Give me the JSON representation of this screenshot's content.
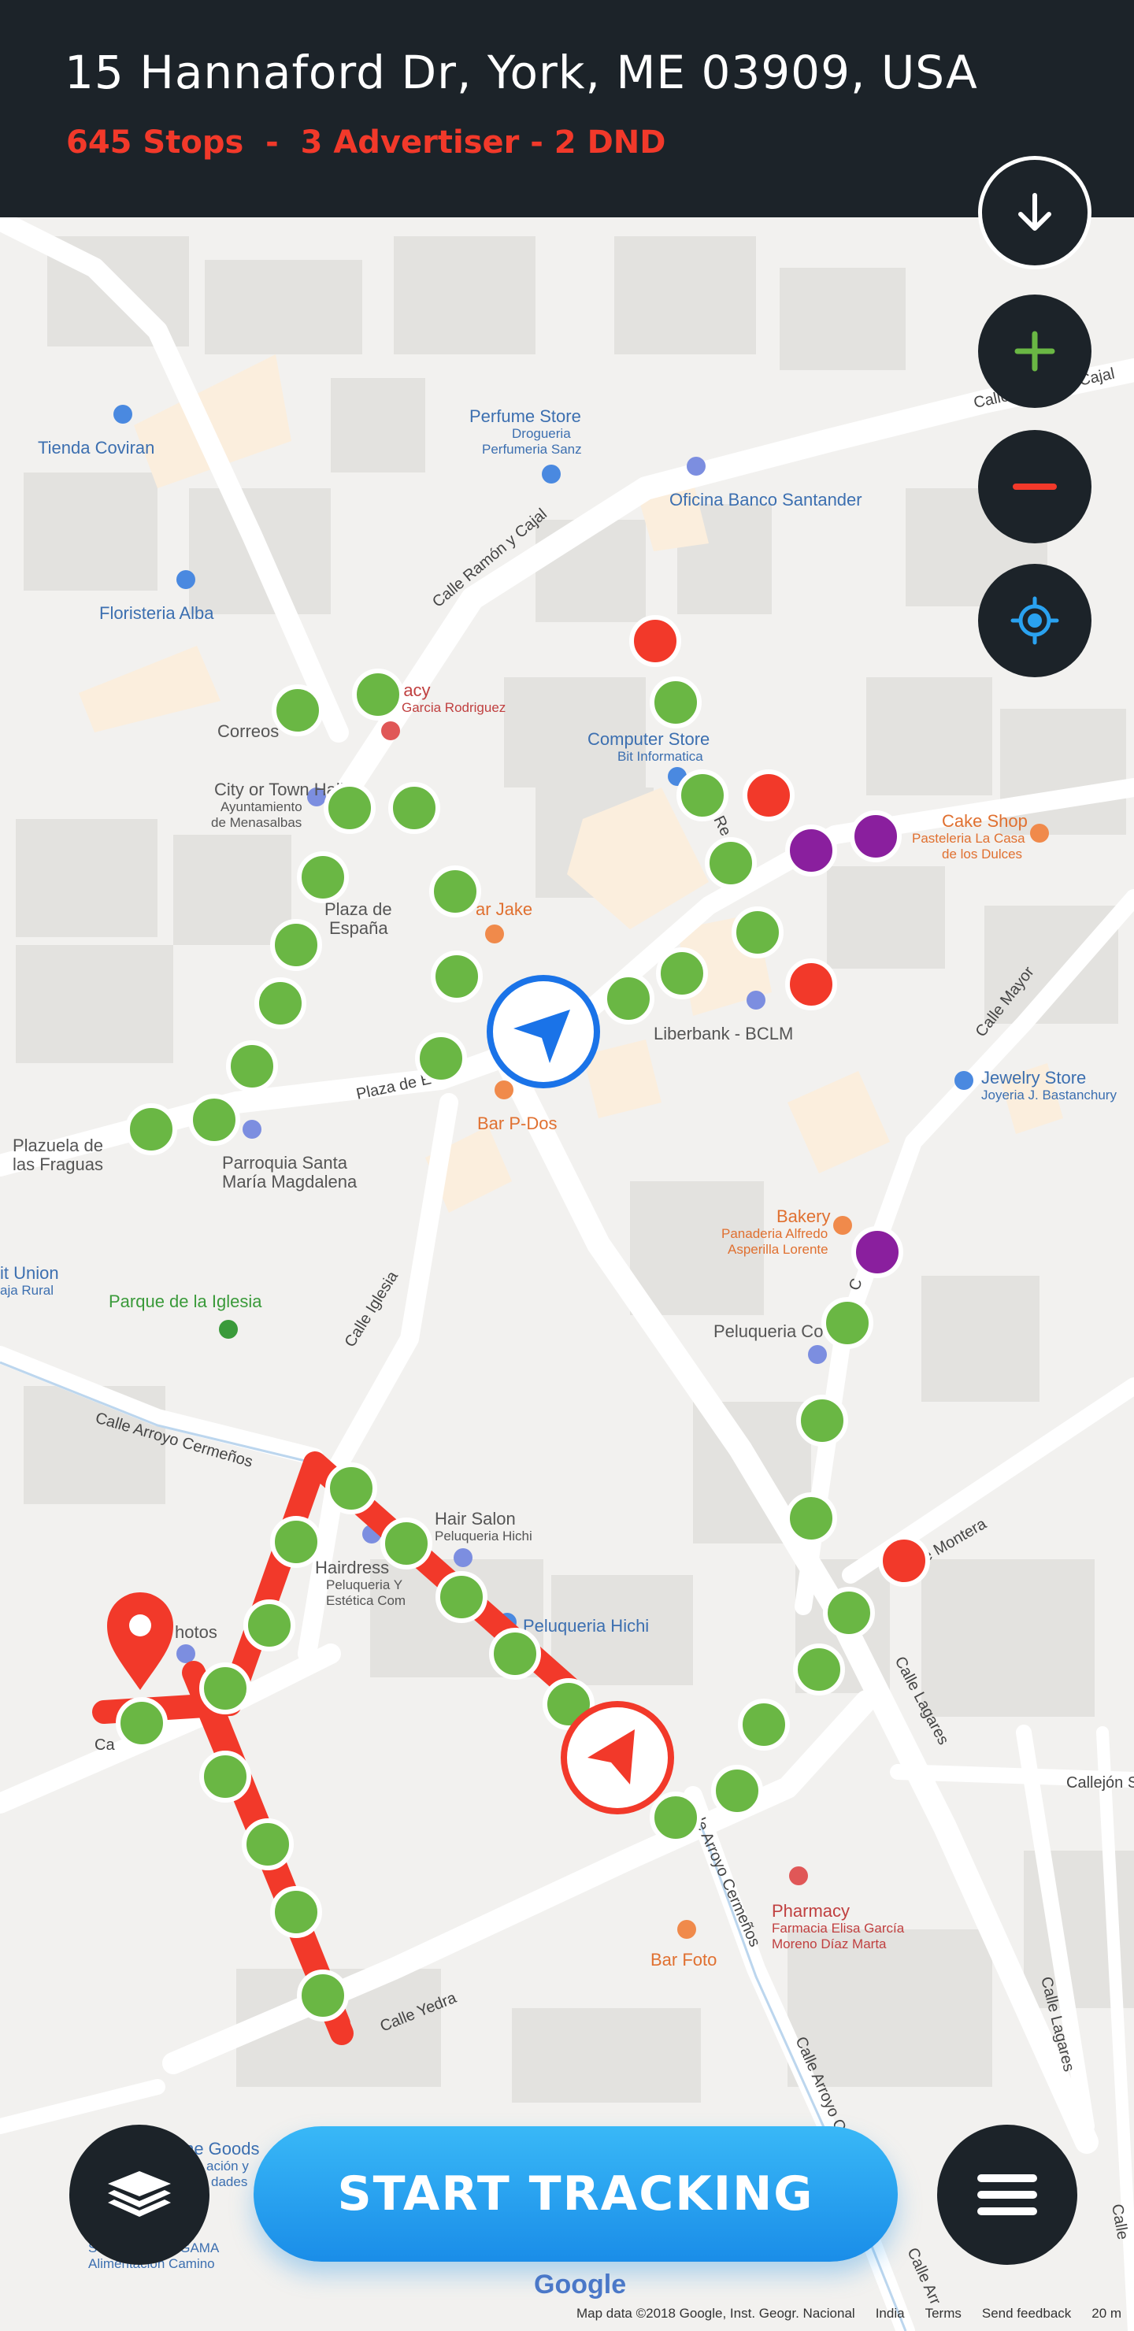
{
  "header": {
    "address": "15 Hannaford Dr, York, ME 03909, USA",
    "summary": "645 Stops  -  3 Advertiser - 2 DND"
  },
  "buttons": {
    "start_tracking": "START TRACKING"
  },
  "icons": {
    "download": "arrow-down-icon",
    "zoom_in": "plus-icon",
    "zoom_out": "minus-icon",
    "locate": "crosshair-icon",
    "layers": "layers-icon",
    "menu": "hamburger-icon"
  },
  "colors": {
    "header_bg": "#1c2329",
    "alert": "#f2392a",
    "stop_green": "#6ab744",
    "stop_red": "#f2392a",
    "stop_purple": "#8a1f9e",
    "route_red": "#f2392a",
    "nav_blue": "#1a73e8",
    "button_blue": "#2aa2f0"
  },
  "map": {
    "poi_labels": [
      {
        "text": "Tienda Coviran",
        "color": "#3c6fb0"
      },
      {
        "text": "Perfume Store",
        "color": "#3c6fb0"
      },
      {
        "text": "Drogueria",
        "color": "#3c6fb0"
      },
      {
        "text": "Perfumeria Sanz",
        "color": "#3c6fb0"
      },
      {
        "text": "Oficina Banco Santander",
        "color": "#3c6fb0"
      },
      {
        "text": "Floristeria Alba",
        "color": "#3c6fb0"
      },
      {
        "text": "Correos",
        "color": "#555555"
      },
      {
        "text": "macy",
        "color": "#c04040"
      },
      {
        "text": "Garcia Rodriguez",
        "color": "#c04040"
      },
      {
        "text": "Computer Store",
        "color": "#3c6fb0"
      },
      {
        "text": "Bit Informatica",
        "color": "#3c6fb0"
      },
      {
        "text": "Cake Shop",
        "color": "#e07030"
      },
      {
        "text": "Pasteleria La Casa",
        "color": "#e07030"
      },
      {
        "text": "de los Dulces",
        "color": "#e07030"
      },
      {
        "text": "City or Town Hall",
        "color": "#555555"
      },
      {
        "text": "Ayuntamiento",
        "color": "#555555"
      },
      {
        "text": "de Menasalbas",
        "color": "#555555"
      },
      {
        "text": "Plaza de",
        "color": "#555555"
      },
      {
        "text": "España",
        "color": "#555555"
      },
      {
        "text": "ar Jake",
        "color": "#e07030"
      },
      {
        "text": "Liberbank - BCLM",
        "color": "#555555"
      },
      {
        "text": "Jewelry Store",
        "color": "#3c6fb0"
      },
      {
        "text": "Joyeria J. Bastanchury",
        "color": "#3c6fb0"
      },
      {
        "text": "Bar P-Dos",
        "color": "#e07030"
      },
      {
        "text": "Plazuela de",
        "color": "#555555"
      },
      {
        "text": "las Fraguas",
        "color": "#555555"
      },
      {
        "text": "Parroquia Santa",
        "color": "#555555"
      },
      {
        "text": "María Magdalena",
        "color": "#555555"
      },
      {
        "text": "Bakery",
        "color": "#e07030"
      },
      {
        "text": "Panaderia Alfredo",
        "color": "#e07030"
      },
      {
        "text": "Asperilla Lorente",
        "color": "#e07030"
      },
      {
        "text": "it Union",
        "color": "#3c6fb0"
      },
      {
        "text": "aja Rural",
        "color": "#3c6fb0"
      },
      {
        "text": "Parque de la Iglesia",
        "color": "#3a9a3a"
      },
      {
        "text": "Peluqueria Co",
        "color": "#555555"
      },
      {
        "text": "Hair Salon",
        "color": "#555555"
      },
      {
        "text": "Peluqueria Hichi",
        "color": "#555555"
      },
      {
        "text": "Hairdress",
        "color": "#555555"
      },
      {
        "text": "Peluqueria Y",
        "color": "#555555"
      },
      {
        "text": "Estética Com",
        "color": "#555555"
      },
      {
        "text": "Peluqueria Hichi",
        "color": "#3c6fb0"
      },
      {
        "text": "hotos",
        "color": "#555555"
      },
      {
        "text": "Pharmacy",
        "color": "#c04040"
      },
      {
        "text": "Farmacia Elisa García",
        "color": "#c04040"
      },
      {
        "text": "Moreno Díaz Marta",
        "color": "#c04040"
      },
      {
        "text": "Bar Foto",
        "color": "#e07030"
      },
      {
        "text": "me Goods",
        "color": "#3c6fb0"
      },
      {
        "text": "Supermercado GAMA",
        "color": "#3c6fb0"
      },
      {
        "text": "Alimentación Camino",
        "color": "#3c6fb0"
      },
      {
        "text": "ación y",
        "color": "#3c6fb0"
      },
      {
        "text": "dades",
        "color": "#3c6fb0"
      }
    ],
    "street_labels": [
      "Calle Ramón y Cajal",
      "Calle Ramón y Cajal",
      "Plaza de E",
      "Calle Mayor",
      "Calle Iglesia",
      "Calle Arroyo Cermeños",
      "le Montera",
      "Calle Lagares",
      "Callejón S",
      "Calle Yedra",
      "le Arroyo Cermeños",
      "Calle Arroyo Cer",
      "Calle Lagares",
      "Calle",
      "Calle Arr",
      "Re",
      "C",
      "Ca"
    ]
  },
  "attribution": {
    "google": "Google",
    "map_data": "Map data ©2018 Google, Inst. Geogr. Nacional",
    "country": "India",
    "terms": "Terms",
    "feedback": "Send feedback",
    "scale": "20 m"
  }
}
